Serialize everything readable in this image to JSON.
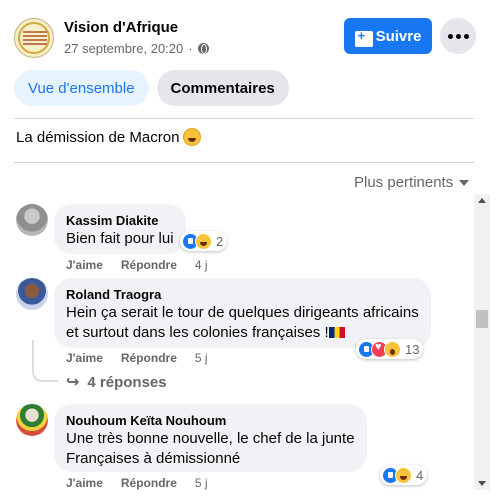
{
  "post": {
    "page_name": "Vision d'Afrique",
    "date": "27 septembre, 20:20",
    "separator": "·",
    "follow_label": "Suivre",
    "text": "La démission de Macron"
  },
  "tabs": [
    {
      "label": "Vue d'ensemble",
      "active": true
    },
    {
      "label": "Commentaires",
      "active": false
    }
  ],
  "sort": {
    "label": "Plus pertinents"
  },
  "actions": {
    "like": "J'aime",
    "reply": "Répondre"
  },
  "comments": [
    {
      "author": "Kassim Diakite",
      "lines": [
        "Bien fait pour lui"
      ],
      "time": "4 j",
      "reactions": [
        "like",
        "haha"
      ],
      "reaction_count": "2"
    },
    {
      "author": "Roland Traogra",
      "lines": [
        "Hein ça serait le tour de quelques dirigeants africains",
        "et surtout dans les colonies françaises !"
      ],
      "time": "5 j",
      "reactions": [
        "like",
        "love",
        "wow"
      ],
      "reaction_count": "13",
      "replies_label": "4 réponses"
    },
    {
      "author": "Nouhoum Keïta Nouhoum",
      "lines": [
        "Une très bonne nouvelle, le chef de la junte",
        "Françaises à démissionné"
      ],
      "time": "5 j",
      "reactions": [
        "like",
        "haha"
      ],
      "reaction_count": "4"
    }
  ],
  "colors": {
    "accent": "#1877f2",
    "bubble": "#f0f2f5",
    "muted": "#65676b"
  }
}
